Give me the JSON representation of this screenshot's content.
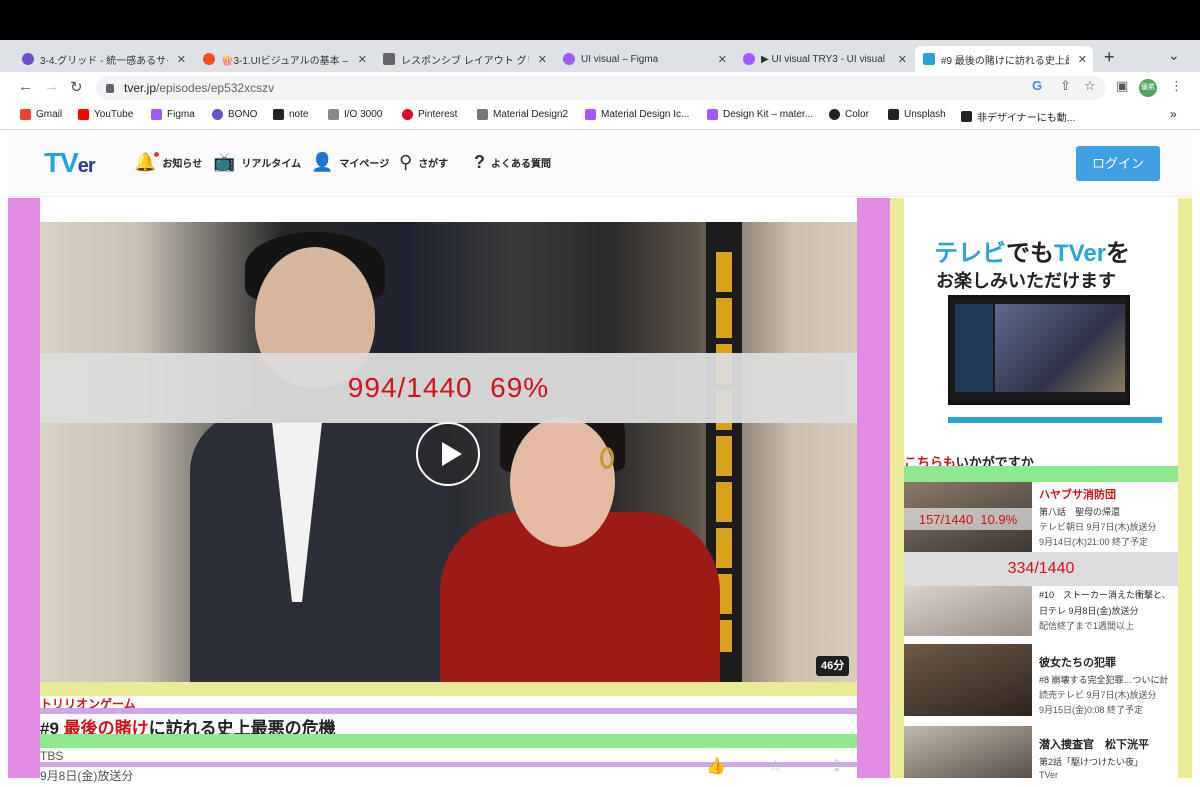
{
  "browser": {
    "tabs": [
      {
        "title": "3-4.グリッド - 統一感あるサイ",
        "icon_color": "#6b4fc7"
      },
      {
        "title": "🍿3-1.UIビジュアルの基本 – F",
        "icon_color": "#f24e1e"
      },
      {
        "title": "レスポンシブ レイアウト グリッド",
        "icon_color": "#666666"
      },
      {
        "title": "UI visual – Figma",
        "icon_color": "#a259ff"
      },
      {
        "title": "▶ UI visual TRY3 - UI visual",
        "icon_color": "#a259ff"
      },
      {
        "title": "#9 最後の賭けに訪れる史上最悪",
        "icon_color": "#29a3d9"
      }
    ],
    "close_glyph": "✕",
    "new_tab_glyph": "+",
    "tab_menu_glyph": "⌄",
    "url_host": "tver.jp",
    "url_path": "/episodes/ep532xcszv",
    "profile_badge": "優希",
    "bookmarks": [
      {
        "label": "Gmail",
        "icon_color": "#ea4335"
      },
      {
        "label": "YouTube",
        "icon_color": "#ff0000"
      },
      {
        "label": "Figma",
        "icon_color": "#a259ff"
      },
      {
        "label": "BONO",
        "icon_color": "#6b4fc7"
      },
      {
        "label": "note",
        "icon_color": "#222222"
      },
      {
        "label": "I/O 3000",
        "icon_color": "#888888"
      },
      {
        "label": "Pinterest",
        "icon_color": "#e60023"
      },
      {
        "label": "Material Design2",
        "icon_color": "#777777"
      },
      {
        "label": "Material Design Ic...",
        "icon_color": "#a259ff"
      },
      {
        "label": "Design Kit – mater...",
        "icon_color": "#a259ff"
      },
      {
        "label": "Color",
        "icon_color": "#222222"
      },
      {
        "label": "Unsplash",
        "icon_color": "#222222"
      },
      {
        "label": "非デザイナーにも動...",
        "icon_color": "#222222"
      }
    ],
    "bookmarks_overflow": "»"
  },
  "header": {
    "logo_a": "TV",
    "logo_b": "er",
    "nav": [
      {
        "label": "お知らせ",
        "icon": "bell-icon"
      },
      {
        "label": "リアルタイム",
        "icon": "tv-icon"
      },
      {
        "label": "マイページ",
        "icon": "user-icon"
      },
      {
        "label": "さがす",
        "icon": "search-icon"
      },
      {
        "label": "よくある質問",
        "icon": "question-icon"
      }
    ],
    "login_label": "ログイン"
  },
  "player": {
    "overlay_text": "994/1440  69%",
    "duration": "46分"
  },
  "episode": {
    "series": "トリリオンゲーム",
    "title_prefix": "#9 ",
    "title_highlight": "最後の賭け",
    "title_rest": "に訪れる史上最悪の危機",
    "station": "TBS",
    "airdate": "9月8日(金)放送分",
    "action_glyphs": [
      "👍",
      "☆",
      "⇪"
    ]
  },
  "sidebar": {
    "ad_line1_a": "テレビ",
    "ad_line1_b": "でも",
    "ad_line1_c": "TVer",
    "ad_line1_d": "を",
    "ad_line2": "お楽しみいただけます",
    "rec_title_red": "こちらも",
    "rec_title_rest": "いかがですか",
    "overlay_small": "157/1440  10.9%",
    "overlay_band": "334/1440",
    "items": [
      {
        "name": "ハヤブサ消防団",
        "sub": "第八話　聖母の帰還",
        "meta1": "テレビ朝日 9月7日(木)放送分",
        "meta2": "9月14日(木)21:00 終了予定",
        "thumb_colors": [
          "#8a7a6a",
          "#3c3530"
        ]
      },
      {
        "name": "#10　ストーカー消えた衝撃と、",
        "sub": "日テレ 9月8日(金)放送分",
        "meta1": "配信終了まで1週間以上",
        "meta2": "",
        "thumb_colors": [
          "#d9d2cc",
          "#9a8e86"
        ]
      },
      {
        "name": "彼女たちの犯罪",
        "sub": "#8 崩壊する完全犯罪…ついに計",
        "meta1": "読売テレビ 9月7日(木)放送分",
        "meta2": "9月15日(金)0:08 終了予定",
        "thumb_colors": [
          "#6e5a45",
          "#2e2520"
        ]
      },
      {
        "name": "潜入捜査官　松下洸平",
        "sub": "第2話「駆けつけたい夜」",
        "meta1": "TVer",
        "meta2": "",
        "thumb_colors": [
          "#c2b8ad",
          "#5a4f47"
        ]
      }
    ]
  }
}
